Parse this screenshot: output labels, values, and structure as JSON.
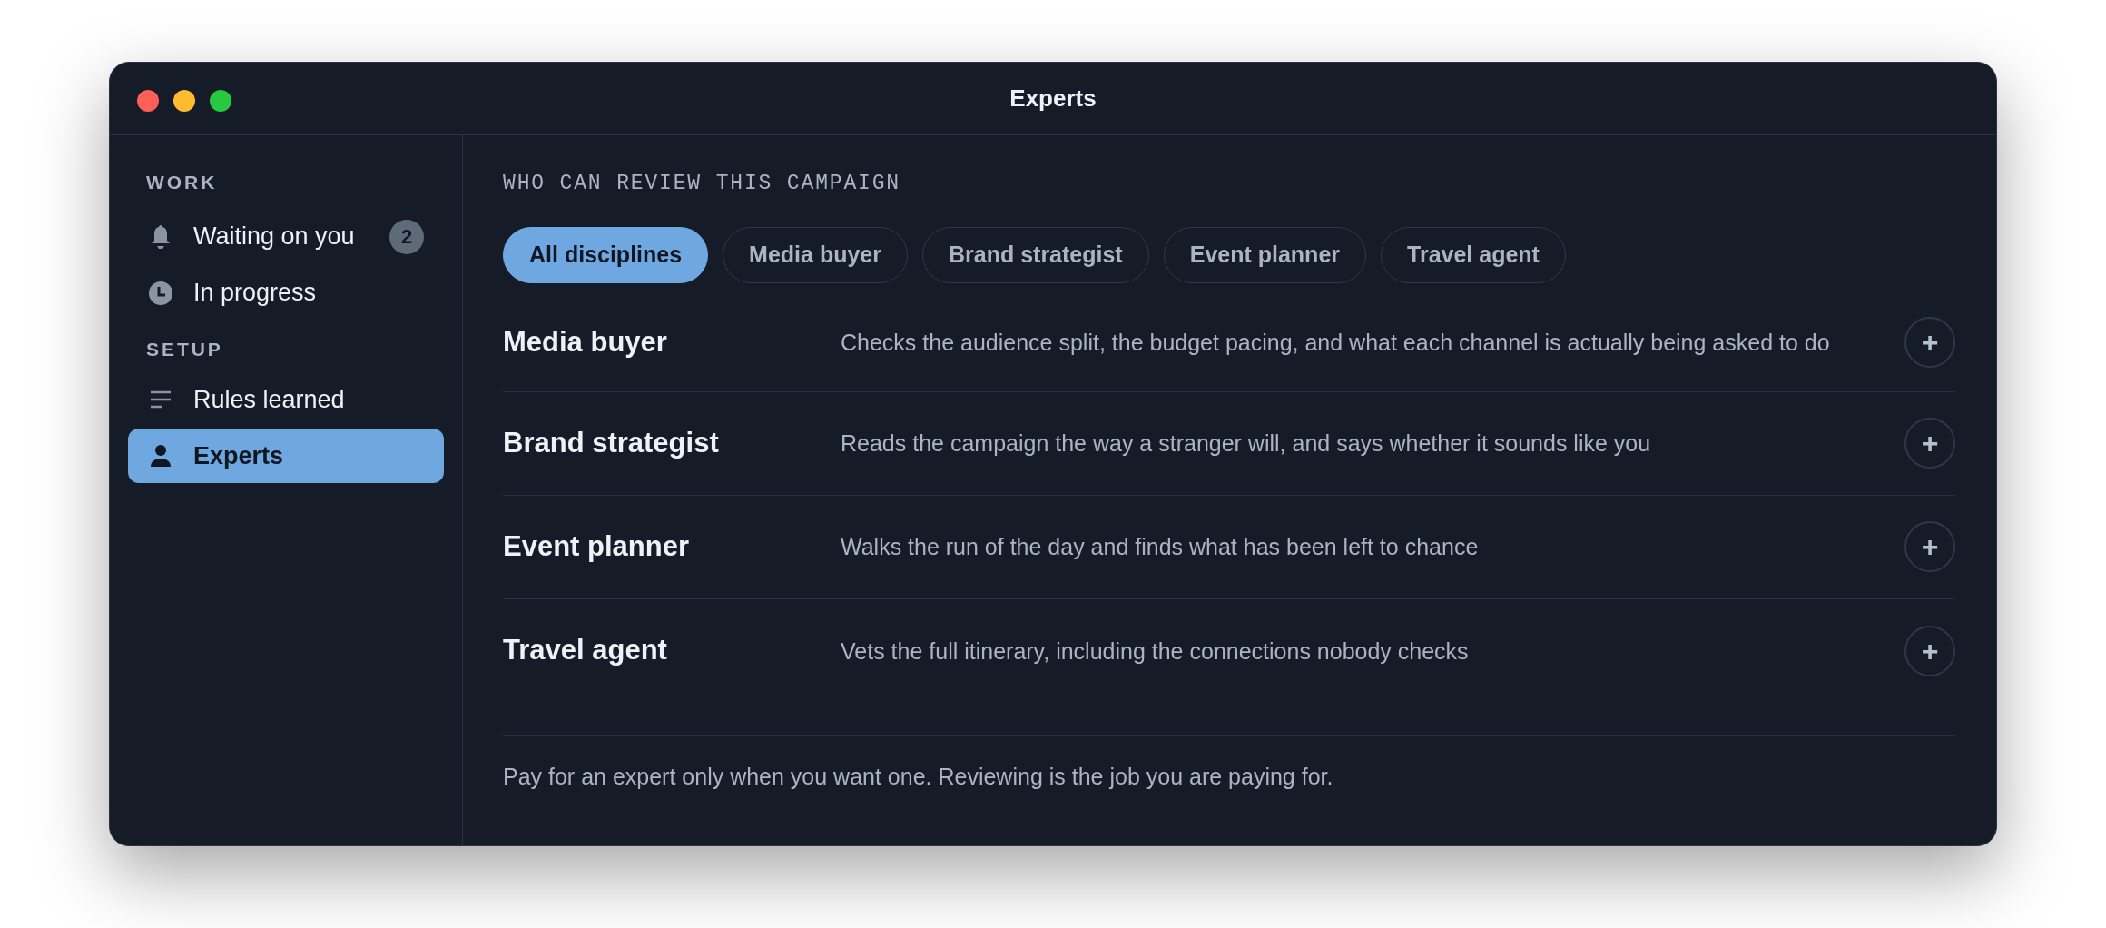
{
  "window": {
    "title": "Experts"
  },
  "sidebar": {
    "sections": [
      {
        "label": "WORK",
        "items": [
          {
            "label": "Waiting on you",
            "badge": "2",
            "selected": false
          },
          {
            "label": "In progress",
            "selected": false
          }
        ]
      },
      {
        "label": "SETUP",
        "items": [
          {
            "label": "Rules learned",
            "selected": false
          },
          {
            "label": "Experts",
            "selected": true
          }
        ]
      }
    ]
  },
  "main": {
    "heading": "WHO CAN REVIEW THIS CAMPAIGN",
    "filters": [
      {
        "label": "All disciplines",
        "selected": true
      },
      {
        "label": "Media buyer",
        "selected": false
      },
      {
        "label": "Brand strategist",
        "selected": false
      },
      {
        "label": "Event planner",
        "selected": false
      },
      {
        "label": "Travel agent",
        "selected": false
      }
    ],
    "experts": [
      {
        "name": "Media buyer",
        "description": "Checks the audience split, the budget pacing, and what each channel is actually being asked to do",
        "add": "+"
      },
      {
        "name": "Brand strategist",
        "description": "Reads the campaign the way a stranger will, and says whether it sounds like you",
        "add": "+"
      },
      {
        "name": "Event planner",
        "description": "Walks the run of the day and finds what has been left to chance",
        "add": "+"
      },
      {
        "name": "Travel agent",
        "description": "Vets the full itinerary, including the connections nobody checks",
        "add": "+"
      }
    ],
    "footer": "Pay for an expert only when you want one. Reviewing is the job you are paying for."
  }
}
